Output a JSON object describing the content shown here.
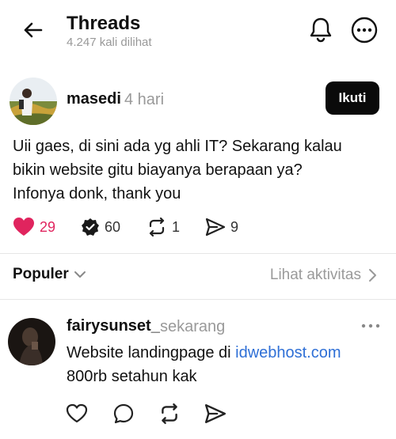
{
  "header": {
    "title": "Threads",
    "views": "4.247 kali dilihat"
  },
  "post": {
    "author": "masedi",
    "time": "4 hari",
    "follow_label": "Ikuti",
    "lines": [
      "Uii gaes, di sini ada yg ahli IT? Sekarang kalau",
      "bikin website gitu biayanya berapaan ya?",
      "Infonya donk, thank you"
    ],
    "stats": {
      "likes": "29",
      "replies": "60",
      "reposts": "1",
      "shares": "9"
    }
  },
  "sort_bar": {
    "sort_label": "Populer",
    "activity_label": "Lihat aktivitas"
  },
  "reply": {
    "author": "fairysunset_",
    "time": "sekarang",
    "line1_prefix": "Website landingpage di ",
    "line1_link": "idwebhost.com",
    "line2": "800rb setahun kak"
  },
  "colors": {
    "like": "#e0245e",
    "link": "#2e6fd6",
    "button": "#0a0a0a"
  },
  "icons": [
    "back-arrow-icon",
    "bell-icon",
    "more-circle-icon",
    "heart-icon",
    "verified-badge-icon",
    "repost-icon",
    "share-icon",
    "chevron-down-icon",
    "chevron-right-icon",
    "ellipsis-icon",
    "comment-icon"
  ]
}
